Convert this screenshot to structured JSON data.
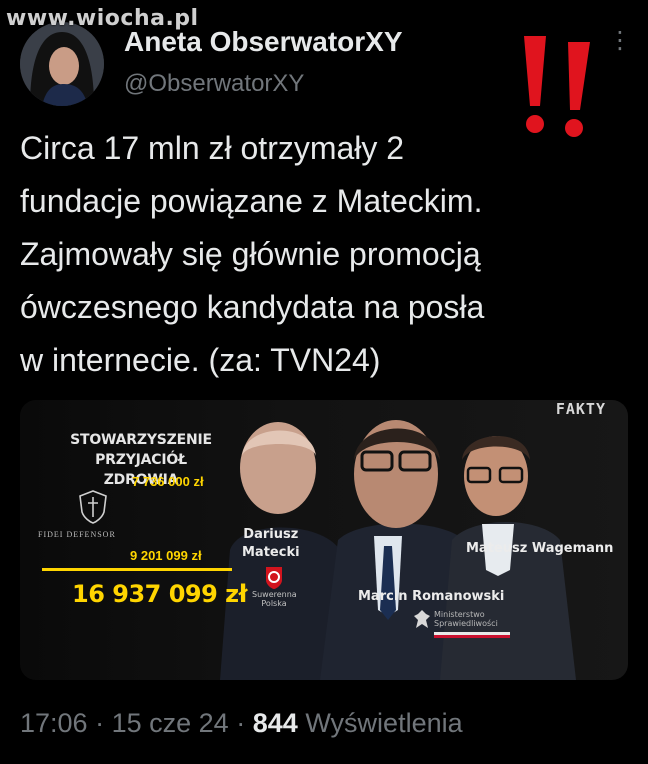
{
  "watermark": "www.wiocha.pl",
  "author": {
    "name": "Aneta ObserwatorXY",
    "handle": "@ObserwatorXY"
  },
  "tweet": {
    "text": "Circa 17 mln zł otrzymały 2\nfundacje powiązane z Mateckim.\nZajmowały się głównie promocją\nówczesnego kandydata na posła\nw internecie.  (za: TVN24)"
  },
  "media": {
    "channel_logo": "FAKTY",
    "org1_name": "STOWARZYSZENIE\nPRZYJACIÓŁ ZDROWIA",
    "org1_amount": "7 736 000 zł",
    "org2_name": "FIDEI DEFENSOR",
    "org2_amount": "9 201 099 zł",
    "total_amount": "16 937 099 zł",
    "person1": "Dariusz\nMatecki",
    "person1_party": "Suwerenna\nPolska",
    "person2": "Marcin Romanowski",
    "person2_org": "Ministerstwo\nSprawiedliwości",
    "person3": "Mateusz Wagemann"
  },
  "meta": {
    "time": "17:06",
    "separator": "·",
    "date": "15 cze 24",
    "views_count": "844",
    "views_label": "Wyświetlenia"
  },
  "colors": {
    "background": "#000000",
    "text": "#e7e9ea",
    "muted": "#71767b",
    "highlight": "#ffd500",
    "exclaim": "#e0141e"
  }
}
